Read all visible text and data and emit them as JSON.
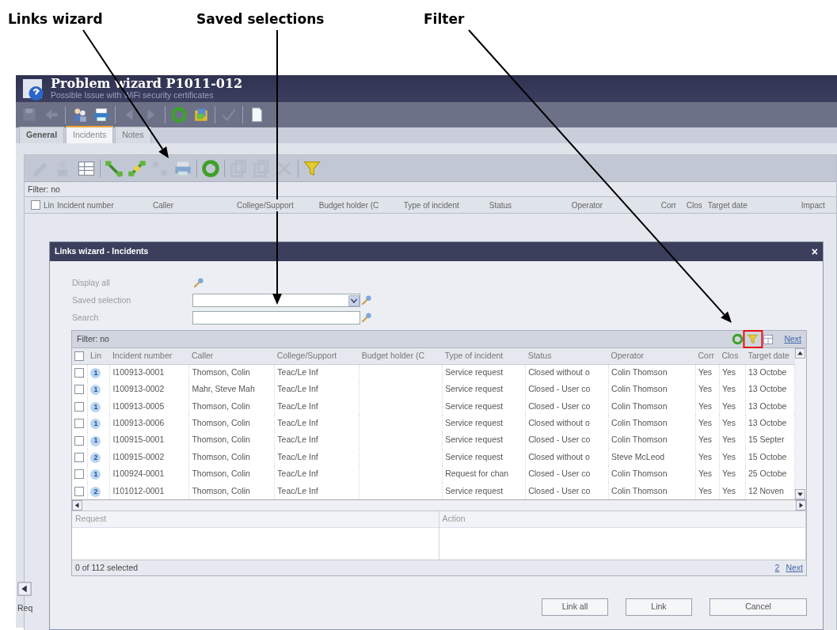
{
  "callouts": [
    {
      "label": "Links wizard"
    },
    {
      "label": "Saved selections"
    },
    {
      "label": "Filter"
    }
  ],
  "window": {
    "title": "Problem wizard P1011-012",
    "subtitle": "Possible Issue with WiFi security certificates"
  },
  "toolbar": [
    {
      "disabled": true
    },
    {
      "disabled": true
    },
    {
      "disabled": false
    },
    {
      "disabled": false
    },
    {
      "disabled": true
    },
    {
      "disabled": true
    },
    {
      "disabled": false
    },
    {
      "disabled": false
    },
    {
      "disabled": true
    },
    {
      "disabled": false
    }
  ],
  "tabs": [
    {
      "label": "General",
      "selected": false
    },
    {
      "label": "Incidents",
      "selected": true
    },
    {
      "label": "Notes",
      "selected": false
    }
  ],
  "panel_toolbar": [
    {
      "disabled": true
    },
    {
      "disabled": true
    },
    {
      "disabled": false
    },
    {
      "disabled": false
    },
    {
      "disabled": false
    },
    {
      "disabled": true
    },
    {
      "disabled": true
    },
    {
      "disabled": false
    },
    {
      "disabled": true
    },
    {
      "disabled": true
    },
    {
      "disabled": true
    },
    {
      "disabled": false
    }
  ],
  "panel_filter": "Filter: no",
  "panel_header_checked": false,
  "panel_columns": [
    "Lin",
    "Incident number",
    "Caller",
    "College/Support",
    "Budget holder (C",
    "Type of incident",
    "Status",
    "Operator",
    "Corr",
    "Clos",
    "Target date",
    "Impact"
  ],
  "panel_bottom_label": "Req",
  "dialog": {
    "title": "Links wizard - Incidents",
    "close": "×",
    "header_checked": false,
    "form": [
      {
        "label": "Display all",
        "kind": "action"
      },
      {
        "label": "Saved selection",
        "kind": "select"
      },
      {
        "label": "Search",
        "kind": "text"
      }
    ],
    "grid_filter": "Filter: no",
    "grid_next": "Next",
    "columns": [
      "Lin",
      "Incident number",
      "Caller",
      "College/Support",
      "Budget holder (C",
      "Type of incident",
      "Status",
      "Operator",
      "Corr",
      "Clos",
      "Target date"
    ],
    "rows": [
      {
        "checked": false,
        "cells": [
          "1",
          "I100913-0001",
          "Thomson, Colin",
          "Teac/Le Inf",
          "",
          "Service request",
          "Closed without o",
          "Colin Thomson",
          "Yes",
          "Yes",
          "13 Octobe"
        ]
      },
      {
        "checked": false,
        "cells": [
          "1",
          "I100913-0002",
          "Mahr, Steve Mah",
          "Teac/Le Inf",
          "",
          "Service request",
          "Closed - User co",
          "Colin Thomson",
          "Yes",
          "Yes",
          "13 Octobe"
        ]
      },
      {
        "checked": false,
        "cells": [
          "1",
          "I100913-0005",
          "Thomson, Colin",
          "Teac/Le Inf",
          "",
          "Service request",
          "Closed - User co",
          "Colin Thomson",
          "Yes",
          "Yes",
          "13 Octobe"
        ]
      },
      {
        "checked": false,
        "cells": [
          "1",
          "I100913-0006",
          "Thomson, Colin",
          "Teac/Le Inf",
          "",
          "Service request",
          "Closed without o",
          "Colin Thomson",
          "Yes",
          "Yes",
          "13 Octobe"
        ]
      },
      {
        "checked": false,
        "cells": [
          "1",
          "I100915-0001",
          "Thomson, Colin",
          "Teac/Le Inf",
          "",
          "Service request",
          "Closed - User co",
          "Colin Thomson",
          "Yes",
          "Yes",
          "15 Septer"
        ]
      },
      {
        "checked": false,
        "cells": [
          "2",
          "I100915-0002",
          "Thomson, Colin",
          "Teac/Le Inf",
          "",
          "Service request",
          "Closed without o",
          "Steve McLeod",
          "Yes",
          "Yes",
          "15 Octobe"
        ]
      },
      {
        "checked": false,
        "cells": [
          "1",
          "I100924-0001",
          "Thomson, Colin",
          "Teac/Le Inf",
          "",
          "Request for chan",
          "Closed - User co",
          "Colin Thomson",
          "Yes",
          "Yes",
          "25 Octobe"
        ]
      },
      {
        "checked": false,
        "cells": [
          "2",
          "I101012-0001",
          "Thomson, Colin",
          "Teac/Le Inf",
          "",
          "Service request",
          "Closed - User co",
          "Colin Thomson",
          "Yes",
          "Yes",
          "12 Noven"
        ]
      }
    ],
    "detail_columns": [
      "Request",
      "Action"
    ],
    "footer": "0 of 112 selected",
    "page": "2",
    "page_next": "Next",
    "buttons": [
      "Link all",
      "Link",
      "Cancel"
    ]
  }
}
